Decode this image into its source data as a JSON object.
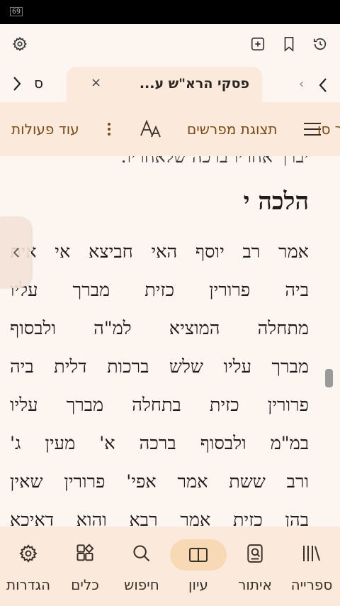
{
  "status_bar": {
    "battery": "69"
  },
  "toolbar": {
    "settings_icon": "gear-icon",
    "add_tab_icon": "plus-square-icon",
    "bookmark_icon": "bookmark-icon",
    "history_icon": "history-icon"
  },
  "tabs": {
    "active_title": "פסקי הרא\"ש ע...",
    "close_label": "×",
    "partial_next_label": "ס",
    "prev_arrow": "‹"
  },
  "actions": {
    "commentators_label": "תצוגת מפרשים",
    "commentators_partial": "ר סו",
    "more_label": "עוד פעולות"
  },
  "content": {
    "top_line": "יברך אחריו ברכה שלאחריו.",
    "heading": "הלכה י",
    "lines": [
      "אמר רב יוסף האי חביצא אי אית",
      "ביה פרורין כזית מברך עליו",
      "מתחלה המוציא למ\"ה ולבסוף",
      "מברך עליו שלש ברכות דלית ביה",
      "פרורין כזית בתחלה מברך עליו",
      "במ\"מ ולבסוף ברכה א' מעין ג'",
      "ורב ששת אמר אפי' פרורין שאין",
      "בהן כזית אמר רבא והוא דאיכא"
    ]
  },
  "bottom_nav": {
    "items": [
      {
        "label": "הגדרות",
        "icon": "gear-icon"
      },
      {
        "label": "כלים",
        "icon": "widgets-icon"
      },
      {
        "label": "חיפוש",
        "icon": "search-icon"
      },
      {
        "label": "עיון",
        "icon": "open-book-icon",
        "active": true
      },
      {
        "label": "איתור",
        "icon": "locate-icon"
      },
      {
        "label": "ספרייה",
        "icon": "library-icon"
      }
    ]
  },
  "colors": {
    "background": "#fdf5ef",
    "panel": "#fbe9dc",
    "accent_text": "#7a4a12",
    "active_pill": "#f7d9b5"
  }
}
